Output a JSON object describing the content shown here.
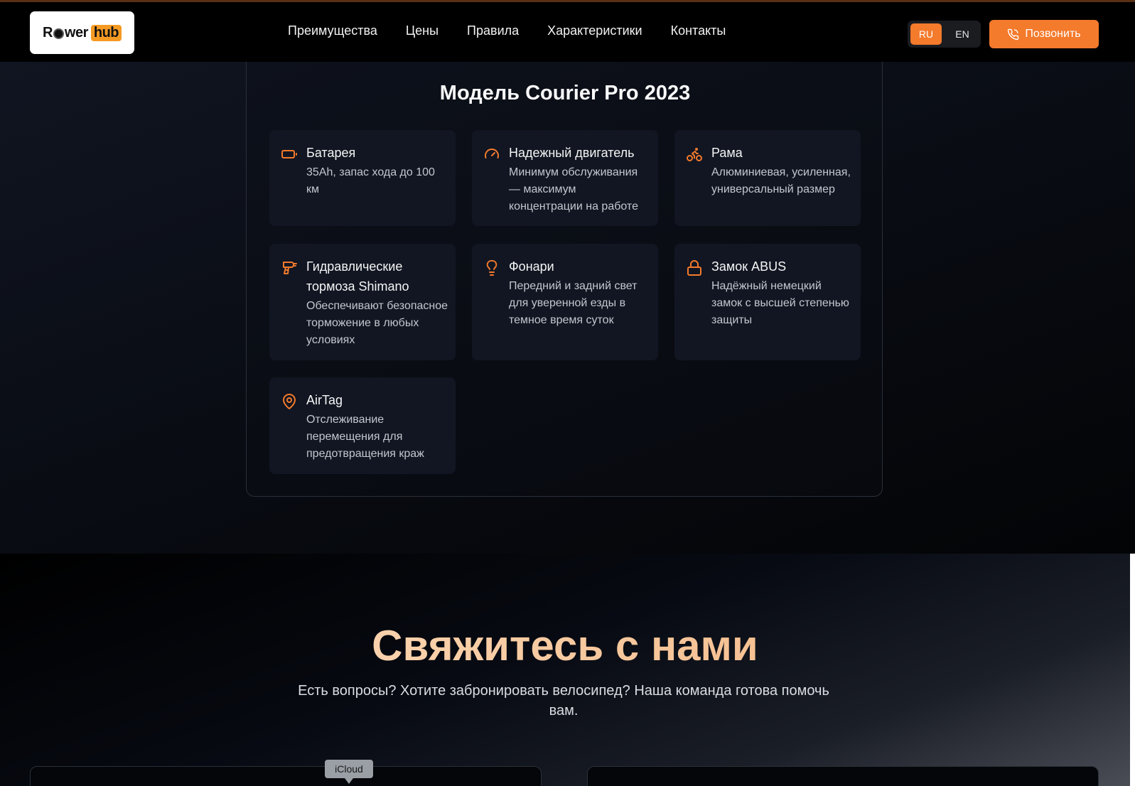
{
  "header": {
    "logo": {
      "part1": "R",
      "part2": "wer",
      "hub": "hub"
    },
    "nav": [
      "Преимущества",
      "Цены",
      "Правила",
      "Характеристики",
      "Контакты"
    ],
    "lang": {
      "ru": "RU",
      "en": "EN",
      "active": "RU"
    },
    "call_label": "Позвонить"
  },
  "specs": {
    "title": "Модель Courier Pro 2023",
    "features": [
      {
        "icon": "battery-icon",
        "title": "Батарея",
        "desc": "35Ah, запас хода до 100 км"
      },
      {
        "icon": "speedometer-icon",
        "title": "Надежный двигатель",
        "desc": "Минимум обслуживания — максимум концентрации на работе"
      },
      {
        "icon": "bike-icon",
        "title": "Рама",
        "desc": "Алюминиевая, усиленная, универсальный размер"
      },
      {
        "icon": "drill-icon",
        "title": "Гидравлические тормоза Shimano",
        "desc": "Обеспечивают безопасное торможение в любых условиях"
      },
      {
        "icon": "bulb-icon",
        "title": "Фонари",
        "desc": "Передний и задний свет для уверенной езды в темное время суток"
      },
      {
        "icon": "lock-icon",
        "title": "Замок ABUS",
        "desc": "Надёжный немецкий замок с высшей степенью защиты"
      },
      {
        "icon": "map-pin-icon",
        "title": "AirTag",
        "desc": "Отслеживание перемещения для предотвращения краж"
      }
    ]
  },
  "contact": {
    "title": "Свяжитесь с нами",
    "subtitle": "Есть вопросы? Хотите забронировать велосипед? Наша команда готова помочь вам."
  },
  "tooltip": "iCloud",
  "colors": {
    "accent": "#f47a2c",
    "title_gradient_start": "#fbe1c4",
    "title_gradient_end": "#f3b27c"
  }
}
